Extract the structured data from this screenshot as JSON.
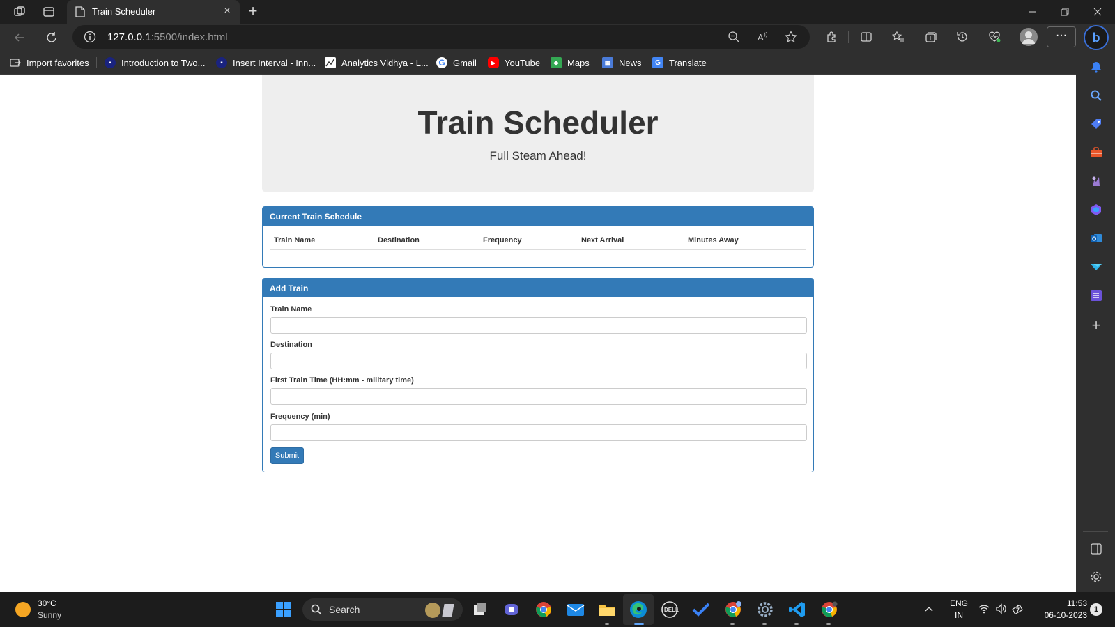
{
  "browser": {
    "tab_title": "Train Scheduler",
    "url_host": "127.0.0.1",
    "url_rest": ":5500/index.html",
    "favorites": [
      {
        "label": "Import favorites",
        "icon": "import-icon"
      },
      {
        "label": "Introduction to Two...",
        "icon": "site-icon"
      },
      {
        "label": "Insert Interval - Inn...",
        "icon": "site-icon"
      },
      {
        "label": "Analytics Vidhya - L...",
        "icon": "analytics-icon"
      },
      {
        "label": "Gmail",
        "icon": "google-icon"
      },
      {
        "label": "YouTube",
        "icon": "youtube-icon"
      },
      {
        "label": "Maps",
        "icon": "maps-icon"
      },
      {
        "label": "News",
        "icon": "news-icon"
      },
      {
        "label": "Translate",
        "icon": "translate-icon"
      }
    ]
  },
  "page": {
    "title": "Train Scheduler",
    "subtitle": "Full Steam Ahead!",
    "schedule": {
      "heading": "Current Train Schedule",
      "columns": [
        "Train Name",
        "Destination",
        "Frequency",
        "Next Arrival",
        "Minutes Away"
      ]
    },
    "add_train": {
      "heading": "Add Train",
      "fields": [
        {
          "label": "Train Name",
          "value": ""
        },
        {
          "label": "Destination",
          "value": ""
        },
        {
          "label": "First Train Time (HH:mm - military time)",
          "value": ""
        },
        {
          "label": "Frequency (min)",
          "value": ""
        }
      ],
      "submit_label": "Submit"
    }
  },
  "taskbar": {
    "weather_temp": "30°C",
    "weather_desc": "Sunny",
    "search_label": "Search",
    "lang_top": "ENG",
    "lang_bottom": "IN",
    "time": "11:53",
    "date": "06-10-2023",
    "notification_count": "1"
  },
  "colors": {
    "panel_primary": "#337ab7",
    "jumbotron_bg": "#eeeeee",
    "chrome_dark": "#2f2f2f"
  }
}
